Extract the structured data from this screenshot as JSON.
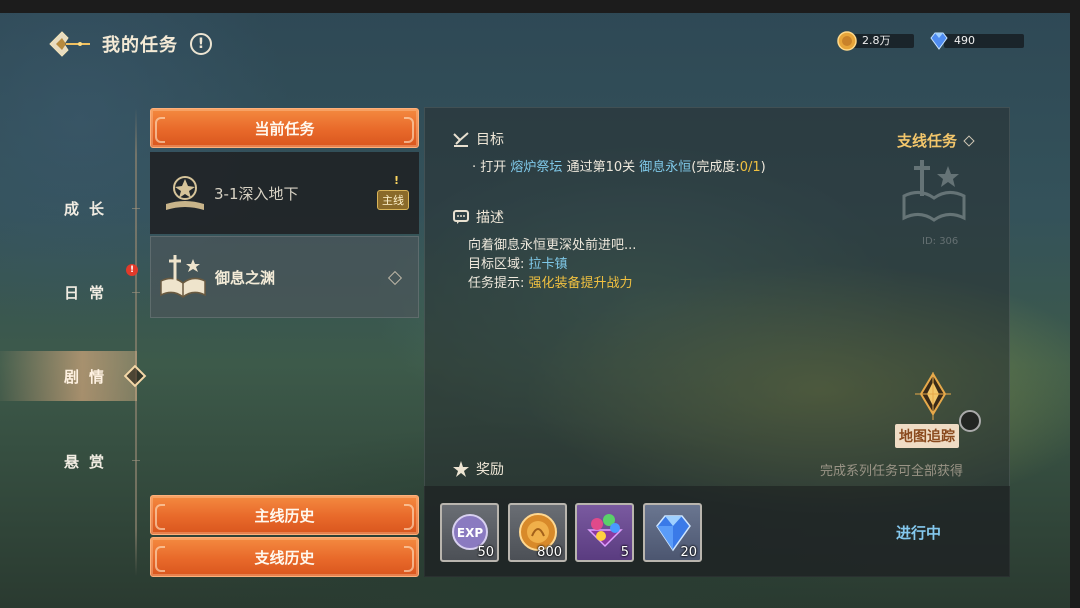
{
  "header": {
    "title": "我的任务",
    "info_label": "!"
  },
  "currency": [
    {
      "icon": "gold-coin-icon",
      "amount": "2.8万"
    },
    {
      "icon": "diamond-icon",
      "amount": "490"
    }
  ],
  "nav": {
    "items": [
      {
        "label": "成长"
      },
      {
        "label": "日常",
        "badge": "!"
      },
      {
        "label": "剧情",
        "active": true
      },
      {
        "label": "悬赏"
      }
    ]
  },
  "current_task_button": "当前任务",
  "quest_list": {
    "current": {
      "name": "3-1深入地下",
      "badge_mark": "!",
      "badge": "主线"
    },
    "series": {
      "name": "御息之渊"
    }
  },
  "history_buttons": {
    "main": "主线历史",
    "branch": "支线历史"
  },
  "detail": {
    "objective_heading": "目标",
    "branch_link": "支线任务",
    "objective": {
      "prefix": "· 打开",
      "place": "熔炉祭坛",
      "middle": "通过第10关",
      "target": "御息永恒",
      "progress_label": "(完成度:",
      "progress_value": "0/1",
      "progress_close": ")"
    },
    "quest_id": "ID: 306",
    "description_heading": "描述",
    "description": "向着御息永恒更深处前进吧...",
    "area_label": "目标区域:",
    "area_value": "拉卡镇",
    "hint_label": "任务提示:",
    "hint_value": "强化装备提升战力",
    "track_label": "地图追踪",
    "reward_heading": "奖励",
    "reward_note": "完成系列任务可全部获得",
    "rewards": [
      {
        "icon": "exp-icon",
        "qty": "50"
      },
      {
        "icon": "gold-coin-icon",
        "qty": "800"
      },
      {
        "icon": "gem-bundle-icon",
        "qty": "5"
      },
      {
        "icon": "diamond-icon",
        "qty": "20"
      }
    ],
    "status": "进行中"
  }
}
